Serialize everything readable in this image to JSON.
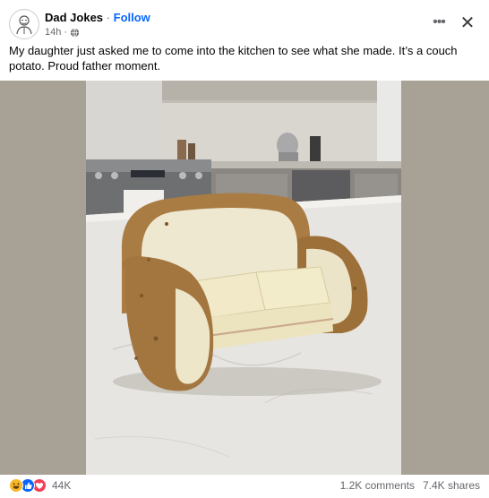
{
  "post": {
    "page_name": "Dad Jokes",
    "separator": "·",
    "follow_label": "Follow",
    "timestamp": "14h",
    "audience_icon": "globe-icon",
    "caption": "My daughter just asked me to come into the kitchen to see what she made. It’s a couch potato. Proud father moment."
  },
  "header_actions": {
    "more_icon": "ellipsis-icon",
    "close_icon": "close-icon"
  },
  "reactions": {
    "types": [
      "haha",
      "like",
      "love"
    ],
    "count": "44K"
  },
  "stats": {
    "comments": "1.2K comments",
    "shares": "7.4K shares"
  },
  "colors": {
    "accent": "#0866ff",
    "muted": "#65676b",
    "text": "#050505"
  }
}
